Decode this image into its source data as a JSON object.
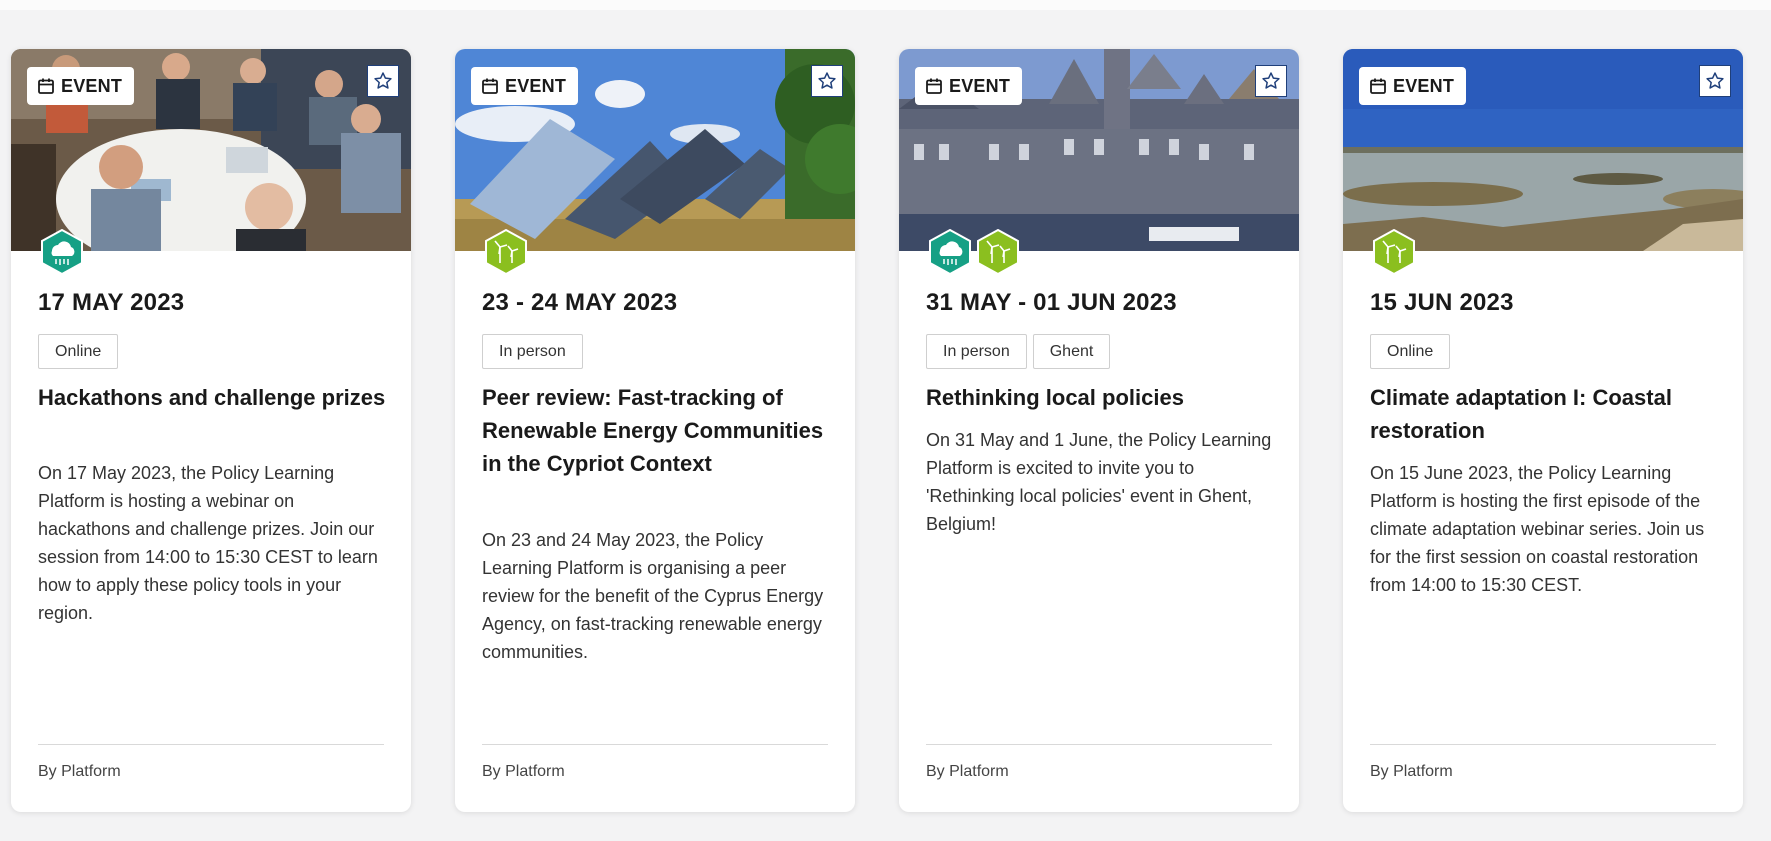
{
  "colors": {
    "accent": "#1f3f7a",
    "climate_topic": "#16a085",
    "energy_topic": "#8bbf1f",
    "tag_border": "#cfcfcf"
  },
  "cards": [
    {
      "type_label": "EVENT",
      "date": "17 MAY 2023",
      "tags": [
        "Online"
      ],
      "title": "Hackathons and challenge prizes",
      "description": "On 17 May 2023, the Policy Learning Platform is hosting a webinar on hackathons and challenge prizes. Join our session from 14:00 to 15:30 CEST to learn how to apply these policy tools in your region.",
      "author": "By Platform",
      "topic_icons": [
        "climate-topic-icon"
      ]
    },
    {
      "type_label": "EVENT",
      "date": "23 - 24 MAY 2023",
      "tags": [
        "In person"
      ],
      "title": "Peer review: Fast-tracking of Renewable Energy Communities in the Cypriot Context",
      "description": "On 23 and 24 May 2023, the Policy Learning Platform is organising a peer review for the benefit of the Cyprus Energy Agency, on fast-tracking renewable energy communities.",
      "author": "By Platform",
      "topic_icons": [
        "energy-topic-icon"
      ]
    },
    {
      "type_label": "EVENT",
      "date": "31 MAY - 01 JUN 2023",
      "tags": [
        "In person",
        "Ghent"
      ],
      "title": "Rethinking local policies",
      "description": "On 31 May and 1 June, the Policy Learning Platform is excited to invite you to 'Rethinking local policies' event in Ghent, Belgium!",
      "author": "By Platform",
      "topic_icons": [
        "climate-topic-icon",
        "energy-topic-icon"
      ]
    },
    {
      "type_label": "EVENT",
      "date": "15 JUN 2023",
      "tags": [
        "Online"
      ],
      "title": "Climate adaptation I: Coastal restoration",
      "description": "On 15 June 2023, the Policy Learning Platform is hosting the first episode of the climate adaptation webinar series. Join us for the first session on coastal restoration from 14:00 to 15:30 CEST.",
      "author": "By Platform",
      "topic_icons": [
        "energy-topic-icon"
      ]
    }
  ]
}
